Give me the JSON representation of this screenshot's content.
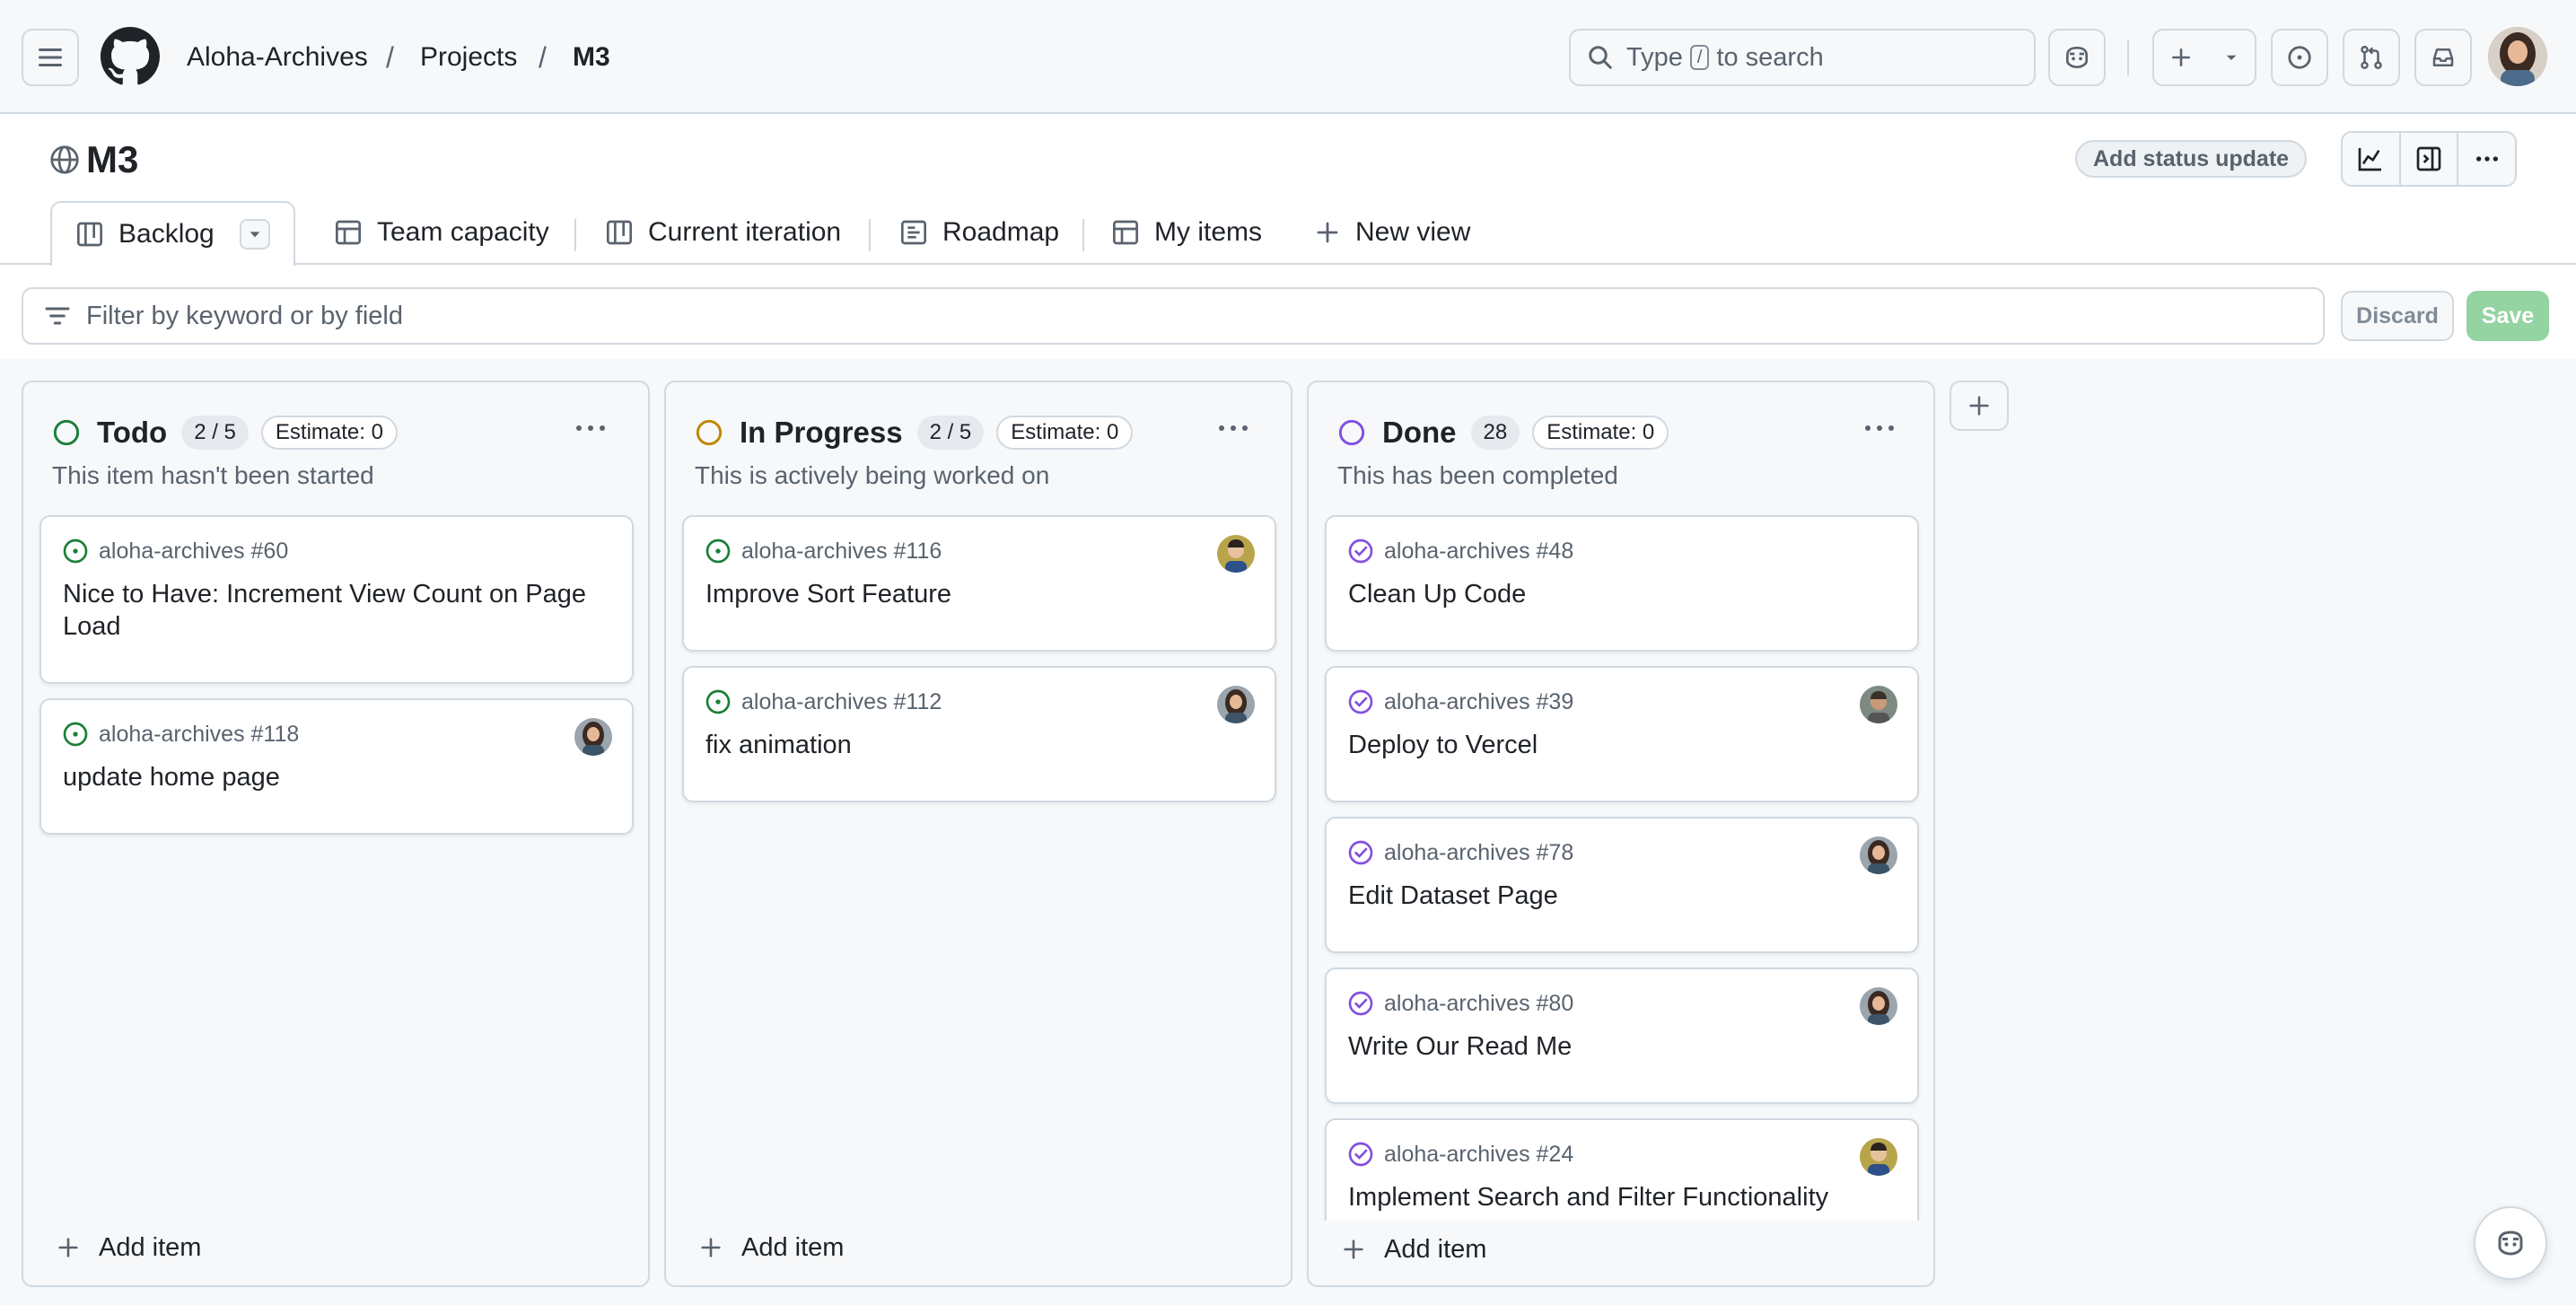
{
  "header": {
    "breadcrumbs": [
      "Aloha-Archives",
      "Projects",
      "M3"
    ],
    "search_prefix": "Type",
    "search_key": "/",
    "search_suffix": "to search"
  },
  "project": {
    "title": "M3",
    "status_update_label": "Add status update"
  },
  "tabs": [
    {
      "label": "Backlog",
      "icon": "board-icon",
      "active": true
    },
    {
      "label": "Team capacity",
      "icon": "table-icon"
    },
    {
      "label": "Current iteration",
      "icon": "board-icon"
    },
    {
      "label": "Roadmap",
      "icon": "roadmap-icon"
    },
    {
      "label": "My items",
      "icon": "table-icon"
    },
    {
      "label": "New view",
      "icon": "plus-icon"
    }
  ],
  "filter": {
    "placeholder": "Filter by keyword or by field",
    "discard_label": "Discard",
    "save_label": "Save"
  },
  "columns": [
    {
      "title": "Todo",
      "count": "2 / 5",
      "estimate": "Estimate: 0",
      "description": "This item hasn't been started",
      "status_color": "#1a7f37",
      "add_label": "Add item",
      "cards": [
        {
          "ref": "aloha-archives #60",
          "title": "Nice to Have: Increment View Count on Page Load",
          "avatar": false
        },
        {
          "ref": "aloha-archives #118",
          "title": "update home page",
          "avatar": true
        }
      ]
    },
    {
      "title": "In Progress",
      "count": "2 / 5",
      "estimate": "Estimate: 0",
      "description": "This is actively being worked on",
      "status_color": "#bf8700",
      "add_label": "Add item",
      "cards": [
        {
          "ref": "aloha-archives #116",
          "title": "Improve Sort Feature",
          "avatar": true
        },
        {
          "ref": "aloha-archives #112",
          "title": "fix animation",
          "avatar": true
        }
      ]
    },
    {
      "title": "Done",
      "count": "28",
      "estimate": "Estimate: 0",
      "description": "This has been completed",
      "status_color": "#8250df",
      "add_label": "Add item",
      "cards": [
        {
          "ref": "aloha-archives #48",
          "title": "Clean Up Code",
          "avatar": false
        },
        {
          "ref": "aloha-archives #39",
          "title": "Deploy to Vercel",
          "avatar": true
        },
        {
          "ref": "aloha-archives #78",
          "title": "Edit Dataset Page",
          "avatar": true
        },
        {
          "ref": "aloha-archives #80",
          "title": "Write Our Read Me",
          "avatar": true
        },
        {
          "ref": "aloha-archives #24",
          "title": "Implement Search and Filter Functionality",
          "avatar": true
        }
      ]
    }
  ]
}
